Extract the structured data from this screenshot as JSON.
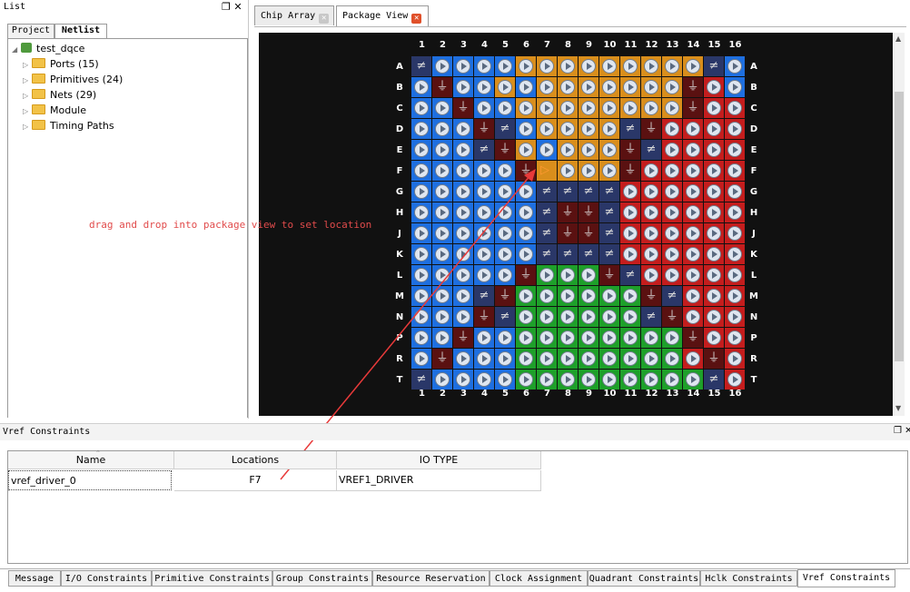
{
  "list_panel": {
    "title": "List",
    "ctrl": "Ɇ ✕",
    "tabs": [
      {
        "label": "Project"
      },
      {
        "label": "Netlist"
      }
    ],
    "tree": {
      "root": "test_dqce",
      "items": [
        {
          "label": "Ports (15)"
        },
        {
          "label": "Primitives (24)"
        },
        {
          "label": "Nets (29)"
        },
        {
          "label": "Module"
        },
        {
          "label": "Timing Paths"
        }
      ]
    }
  },
  "hint_text": "drag and drop into package view to set location",
  "tabs": [
    {
      "label": "Chip Array"
    },
    {
      "label": "Package View"
    }
  ],
  "package": {
    "columns": [
      "1",
      "2",
      "3",
      "4",
      "5",
      "6",
      "7",
      "8",
      "9",
      "10",
      "11",
      "12",
      "13",
      "14",
      "15",
      "16"
    ],
    "rows": [
      "A",
      "B",
      "C",
      "D",
      "E",
      "F",
      "G",
      "H",
      "J",
      "K",
      "L",
      "M",
      "N",
      "P",
      "R",
      "T"
    ],
    "bank_colors": {
      "blue": "#1e6fe0",
      "orange": "#d98e1c",
      "red": "#c41d1d",
      "green": "#1ea02a",
      "navy": "#2a3768",
      "maroon": "#5a1111"
    },
    "selected": "F7"
  },
  "vref": {
    "title": "Vref Constraints",
    "ctrl": "Ɇ ✕",
    "columns": [
      "Name",
      "Locations",
      "IO TYPE"
    ],
    "rows": [
      {
        "name": "vref_driver_0",
        "location": "F7",
        "io_type": "VREF1_DRIVER"
      }
    ]
  },
  "bottom_tabs": [
    {
      "label": "Message"
    },
    {
      "label": "I/O Constraints"
    },
    {
      "label": "Primitive Constraints"
    },
    {
      "label": "Group Constraints"
    },
    {
      "label": "Resource Reservation"
    },
    {
      "label": "Clock Assignment"
    },
    {
      "label": "Quadrant Constraints"
    },
    {
      "label": "Hclk Constraints"
    },
    {
      "label": "Vref Constraints"
    }
  ]
}
